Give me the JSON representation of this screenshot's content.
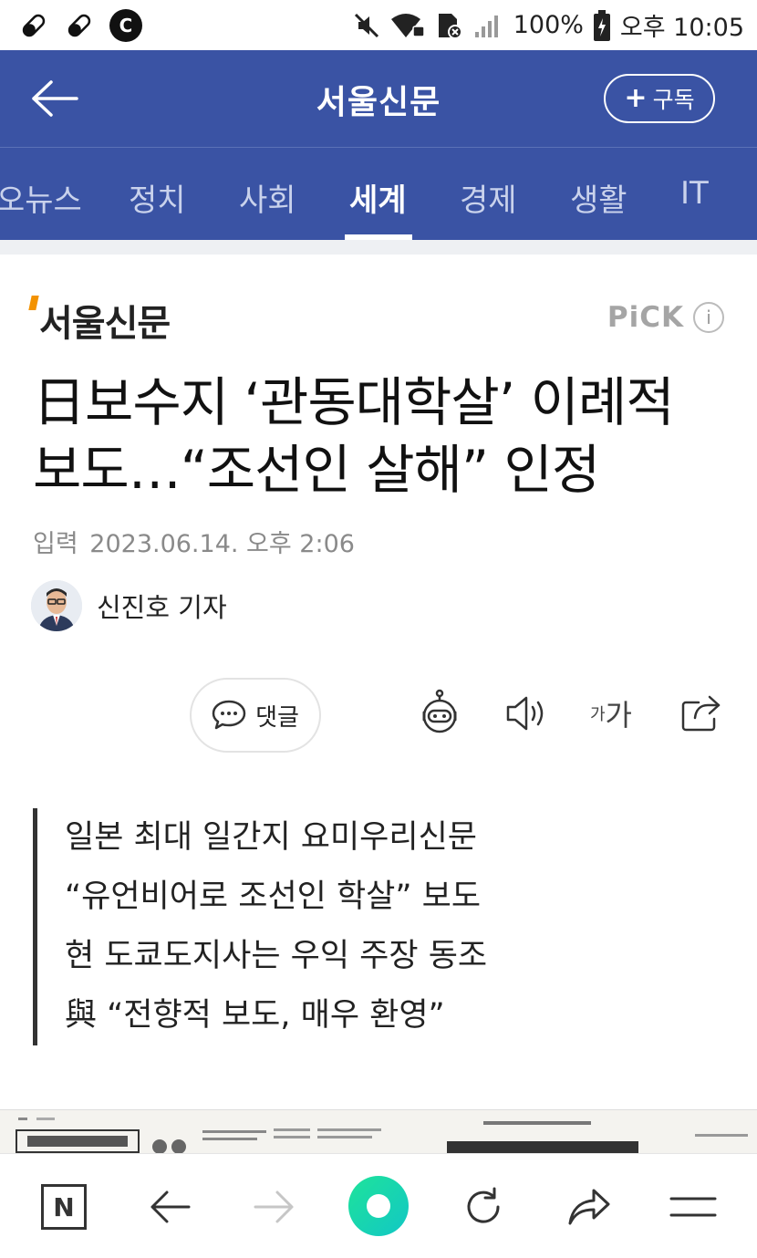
{
  "status_bar": {
    "battery": "100%",
    "time": "오후 10:05",
    "left_icons": [
      "pill-icon",
      "pill-icon",
      "c-app-icon"
    ],
    "right_icons": [
      "mute-icon",
      "wifi-lock-icon",
      "nfc-icon",
      "signal-icon",
      "battery-charging-icon"
    ],
    "c_icon_letter": "C"
  },
  "header": {
    "title": "서울신문",
    "subscribe_label": "구독",
    "subscribe_plus": "+",
    "background": "#3a53a4"
  },
  "tabs": [
    {
      "label": "오뉴스",
      "active": false
    },
    {
      "label": "정치",
      "active": false
    },
    {
      "label": "사회",
      "active": false
    },
    {
      "label": "세계",
      "active": true
    },
    {
      "label": "경제",
      "active": false
    },
    {
      "label": "생활",
      "active": false
    },
    {
      "label": "IT",
      "active": false
    }
  ],
  "article": {
    "press_name": "서울신문",
    "pick_label": "PiCK",
    "pick_info": "i",
    "title_line1": "日보수지 ‘관동대학살’ 이례적",
    "title_line2": "보도…“조선인 살해” 인정",
    "date_label": "입력",
    "date_value": "2023.06.14. 오후 2:06",
    "reporter": "신진호 기자",
    "comment_label": "댓글",
    "font_small": "가",
    "font_large": "가",
    "summary": [
      "일본 최대 일간지 요미우리신문",
      "“유언비어로 조선인 학살” 보도",
      "현 도쿄도지사는 우익 주장 동조",
      "與 “전향적 보도, 매우 환영”"
    ]
  },
  "bottom_nav": {
    "home_label": "N",
    "icons": [
      "naver-home-icon",
      "back-arrow-icon",
      "forward-arrow-icon",
      "green-dot-icon",
      "refresh-icon",
      "share-icon",
      "menu-icon"
    ]
  }
}
